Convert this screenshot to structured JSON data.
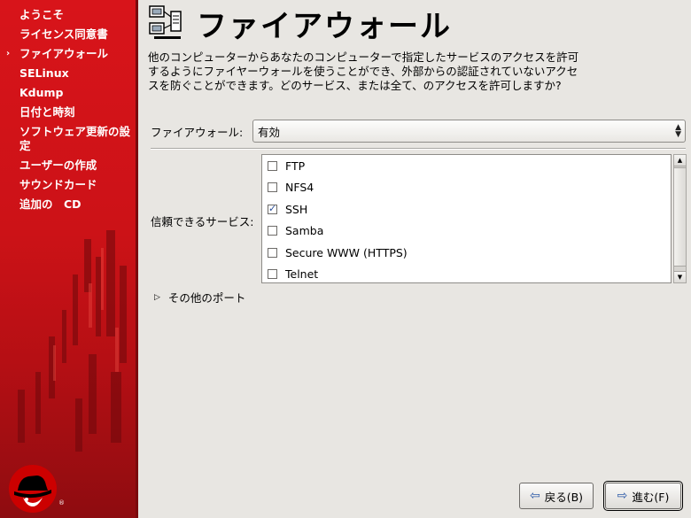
{
  "sidebar": {
    "items": [
      {
        "label": "ようこそ",
        "current": false
      },
      {
        "label": "ライセンス同意書",
        "current": false
      },
      {
        "label": "ファイアウォール",
        "current": true
      },
      {
        "label": "SELinux",
        "current": false
      },
      {
        "label": "Kdump",
        "current": false
      },
      {
        "label": "日付と時刻",
        "current": false
      },
      {
        "label": "ソフトウェア更新の設定",
        "current": false
      },
      {
        "label": "ユーザーの作成",
        "current": false
      },
      {
        "label": "サウンドカード",
        "current": false
      },
      {
        "label": "追加の　CD",
        "current": false
      }
    ],
    "current_marker": "›",
    "brand_color": "#cc1217"
  },
  "header": {
    "title": "ファイアウォール",
    "icon": "firewall-network-icon"
  },
  "description": "他のコンピューターからあなたのコンピューターで指定したサービスのアクセスを許可するようにファイヤーウォールを使うことができ、外部からの認証されていないアクセスを防ぐことができます。どのサービス、または全て、のアクセスを許可しますか?",
  "firewall": {
    "label": "ファイアウォール:",
    "selected": "有効"
  },
  "services": {
    "label": "信頼できるサービス:",
    "items": [
      {
        "name": "FTP",
        "checked": false
      },
      {
        "name": "NFS4",
        "checked": false
      },
      {
        "name": "SSH",
        "checked": true
      },
      {
        "name": "Samba",
        "checked": false
      },
      {
        "name": "Secure WWW (HTTPS)",
        "checked": false
      },
      {
        "name": "Telnet",
        "checked": false
      }
    ]
  },
  "other_ports": {
    "label": "その他のポート"
  },
  "buttons": {
    "back_label": "戻る(B)",
    "next_label": "進む(F)"
  }
}
